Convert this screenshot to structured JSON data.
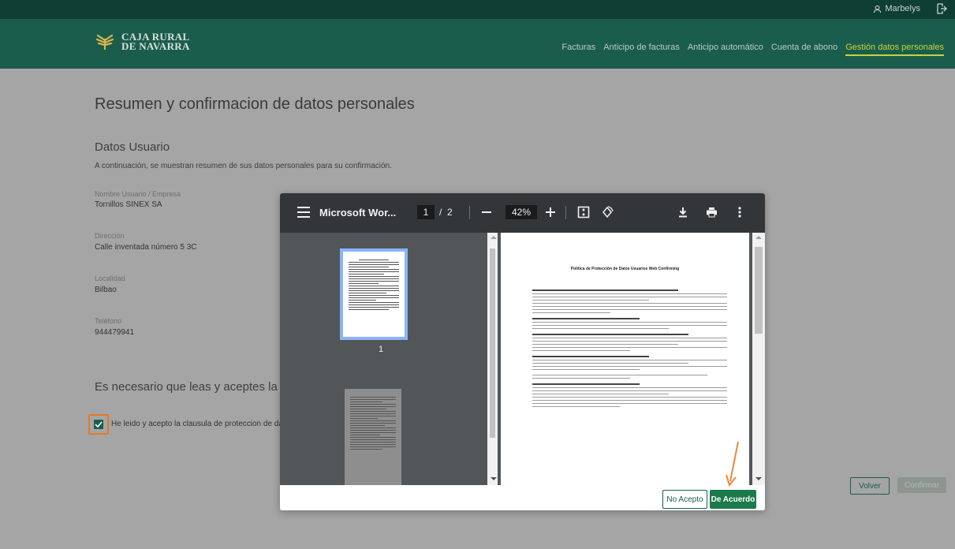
{
  "topbar": {
    "user_name": "Marbelys"
  },
  "brand": {
    "line1": "CAJA RURAL",
    "line2": "DE NAVARRA"
  },
  "nav": [
    {
      "label": "Facturas"
    },
    {
      "label": "Anticipo de facturas"
    },
    {
      "label": "Anticipo automático"
    },
    {
      "label": "Cuenta de abono"
    },
    {
      "label": "Gestión datos personales",
      "active": true
    }
  ],
  "page": {
    "title": "Resumen y confirmacion de datos personales",
    "section_title": "Datos Usuario",
    "section_desc": "A continuación, se muestran resumen de sus datos personales para su confirmación.",
    "fields": [
      {
        "label": "Nombre Usuario / Empresa",
        "value": "Tornillos SINEX SA"
      },
      {
        "label": "Dirección",
        "value": "Calle inventada número 5 3C"
      },
      {
        "label": "Localidad",
        "value": "Bilbao"
      },
      {
        "label": "Teléfono",
        "value": "944479941"
      }
    ],
    "accept_title": "Es necesario que leas y aceptes la sigui",
    "checkbox_label": "He leido y acepto la clausula de proteccion de datos",
    "checkbox_checked": true,
    "volver_label": "Volver",
    "confirmar_label": "Confirmar"
  },
  "pdf_viewer": {
    "title": "Microsoft Wor...",
    "current_page": "1",
    "page_separator": "/",
    "total_pages": "2",
    "zoom": "42%",
    "thumb_label": "1",
    "document_title": "Política de Protección de Datos Usuarios Web Confirming"
  },
  "modal": {
    "reject_label": "No Acepto",
    "accept_label": "De Acuerdo"
  },
  "colors": {
    "header_green": "#1b5d4d",
    "active_nav": "#c4d53a",
    "accept_button": "#1b7a4a",
    "highlight_orange": "#e07a2a"
  }
}
